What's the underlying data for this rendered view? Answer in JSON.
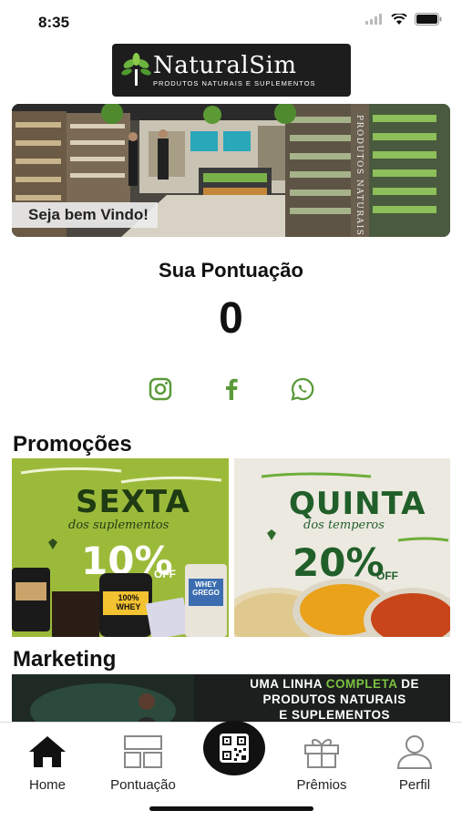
{
  "status_bar": {
    "time": "8:35"
  },
  "logo": {
    "name": "NaturalSim",
    "tagline": "PRODUTOS NATURAIS E SUPLEMENTOS"
  },
  "hero": {
    "caption": "Seja bem Vindo!",
    "sign_text": "PRODUTOS NATURAIS"
  },
  "score": {
    "title": "Sua Pontuação",
    "value": "0"
  },
  "social": {
    "icons": [
      "instagram-icon",
      "facebook-icon",
      "whatsapp-icon"
    ],
    "color": "#5a9a3a"
  },
  "promotions": {
    "title": "Promoções",
    "items": [
      {
        "headline": "SEXTA",
        "subline": "dos suplementos",
        "discount": "10%",
        "off": "OFF",
        "product_label": "100% WHEY",
        "product2_label": "WHEY GREGO"
      },
      {
        "headline": "QUINTA",
        "subline": "dos temperos",
        "discount": "20%",
        "off": "OFF"
      }
    ]
  },
  "marketing": {
    "title": "Marketing",
    "line1_prefix": "UMA LINHA ",
    "line1_highlight": "COMPLETA",
    "line1_suffix": " DE",
    "line2": "PRODUTOS NATURAIS",
    "line3": "E SUPLEMENTOS"
  },
  "nav": {
    "items": [
      {
        "label": "Home",
        "icon": "home-icon"
      },
      {
        "label": "Pontuação",
        "icon": "layout-icon"
      },
      {
        "label": "",
        "icon": "qr-code-icon"
      },
      {
        "label": "Prêmios",
        "icon": "gift-icon"
      },
      {
        "label": "Perfil",
        "icon": "user-icon"
      }
    ]
  }
}
